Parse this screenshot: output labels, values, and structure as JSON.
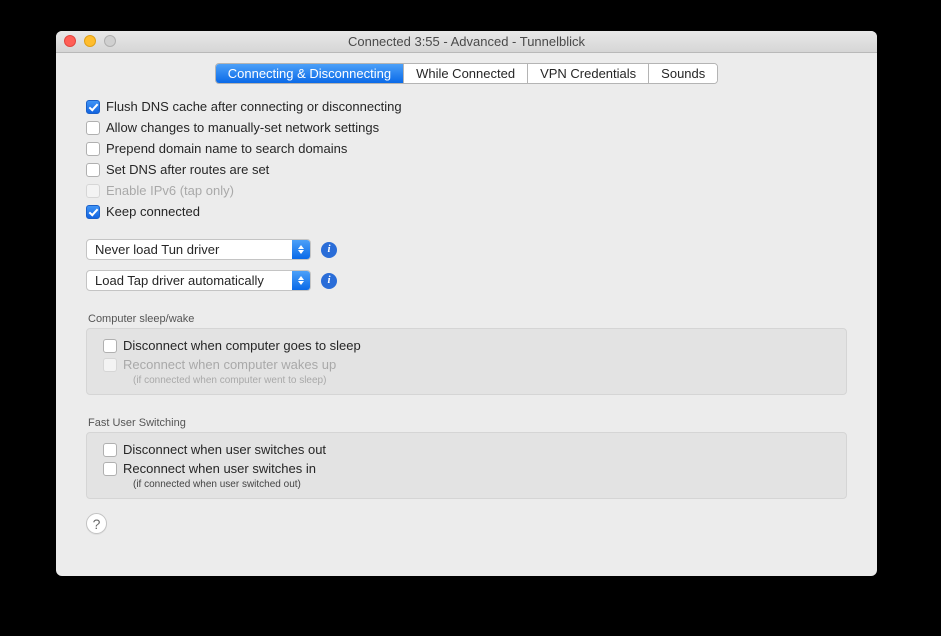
{
  "window": {
    "title": "Connected 3:55 - Advanced - Tunnelblick"
  },
  "tabs": [
    {
      "label": "Connecting & Disconnecting",
      "selected": true
    },
    {
      "label": "While Connected",
      "selected": false
    },
    {
      "label": "VPN Credentials",
      "selected": false
    },
    {
      "label": "Sounds",
      "selected": false
    }
  ],
  "options": {
    "flush_dns": {
      "label": "Flush DNS cache after connecting or disconnecting",
      "checked": true,
      "disabled": false
    },
    "allow_changes": {
      "label": "Allow changes to manually-set network settings",
      "checked": false,
      "disabled": false
    },
    "prepend_domain": {
      "label": "Prepend domain name to search domains",
      "checked": false,
      "disabled": false
    },
    "set_dns_routes": {
      "label": "Set DNS after routes are set",
      "checked": false,
      "disabled": false
    },
    "enable_ipv6": {
      "label": "Enable IPv6 (tap only)",
      "checked": false,
      "disabled": true
    },
    "keep_connected": {
      "label": "Keep connected",
      "checked": true,
      "disabled": false
    }
  },
  "tun_driver": {
    "value": "Never load Tun driver"
  },
  "tap_driver": {
    "value": "Load Tap driver automatically"
  },
  "sleep_group": {
    "label": "Computer sleep/wake",
    "disconnect_sleep": {
      "label": "Disconnect when computer goes to sleep",
      "checked": false,
      "disabled": false
    },
    "reconnect_wake": {
      "label": "Reconnect when computer wakes up",
      "checked": false,
      "disabled": true
    },
    "note": "(if connected when computer went to sleep)"
  },
  "fus_group": {
    "label": "Fast User Switching",
    "disconnect_out": {
      "label": "Disconnect when user switches out",
      "checked": false,
      "disabled": false
    },
    "reconnect_in": {
      "label": "Reconnect when user switches in",
      "checked": false,
      "disabled": false
    },
    "note": "(if connected when user switched out)"
  },
  "help_glyph": "?"
}
